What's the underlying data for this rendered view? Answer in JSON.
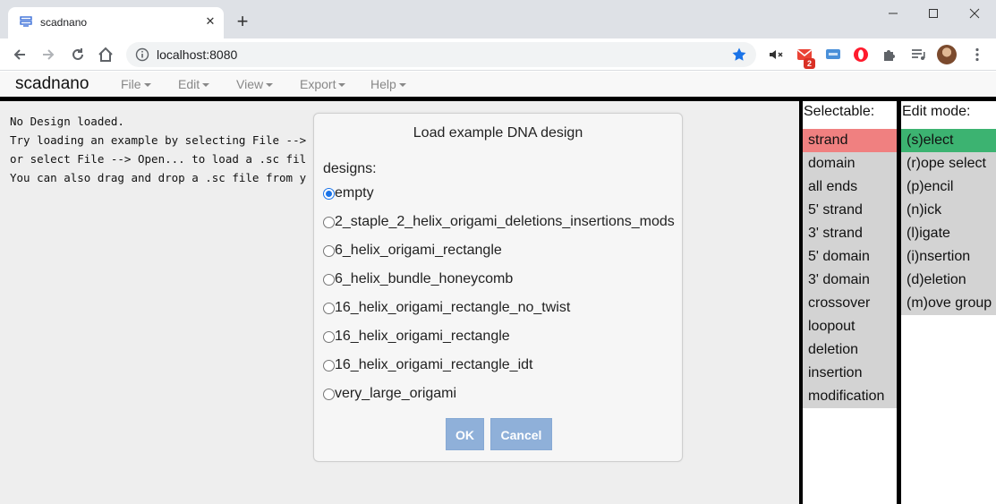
{
  "browser": {
    "tab_title": "scadnano",
    "url": "localhost:8080",
    "gmail_badge": "2"
  },
  "app": {
    "brand": "scadnano",
    "menus": [
      "File",
      "Edit",
      "View",
      "Export",
      "Help"
    ]
  },
  "main": {
    "message_lines": [
      "No Design loaded.",
      "Try loading an example by selecting File -->",
      "or select File --> Open... to load a .sc fil",
      "You can also drag and drop a .sc file from y"
    ]
  },
  "dialog": {
    "title": "Load example DNA design",
    "label": "designs:",
    "selected_index": 0,
    "designs": [
      "empty",
      "2_staple_2_helix_origami_deletions_insertions_mods",
      "6_helix_origami_rectangle",
      "6_helix_bundle_honeycomb",
      "16_helix_origami_rectangle_no_twist",
      "16_helix_origami_rectangle",
      "16_helix_origami_rectangle_idt",
      "very_large_origami"
    ],
    "ok_label": "OK",
    "cancel_label": "Cancel"
  },
  "selectable": {
    "title": "Selectable:",
    "active_color": "#f08080",
    "items": [
      "strand",
      "domain",
      "all ends",
      "5' strand",
      "3' strand",
      "5' domain",
      "3' domain",
      "crossover",
      "loopout",
      "deletion",
      "insertion",
      "modification"
    ],
    "active_index": 0
  },
  "edit_mode": {
    "title": "Edit mode:",
    "active_color": "#3cb371",
    "items": [
      "(s)elect",
      "(r)ope select",
      "(p)encil",
      "(n)ick",
      "(l)igate",
      "(i)nsertion",
      "(d)eletion",
      "(m)ove group"
    ],
    "active_index": 0
  }
}
